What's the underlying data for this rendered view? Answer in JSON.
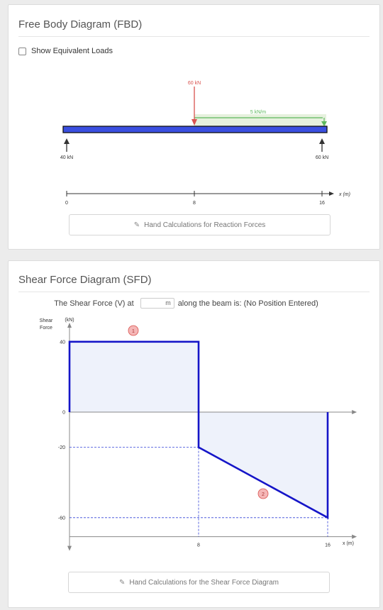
{
  "fbd": {
    "title": "Free Body Diagram (FBD)",
    "checkbox_label": "Show Equivalent Loads",
    "point_load_label": "60 kN",
    "dist_load_label": "5 kN/m",
    "reaction_left_label": "40 kN",
    "reaction_right_label": "60 kN",
    "axis_ticks": [
      "0",
      "8",
      "16"
    ],
    "axis_label": "x (m)",
    "calc_button_label": "Hand Calculations for Reaction Forces",
    "colors": {
      "beam": "#3a4fe0",
      "point_load": "#d9534f",
      "dist_load": "#5cb85c"
    }
  },
  "sfd": {
    "title": "Shear Force Diagram (SFD)",
    "query_prefix": "The Shear Force (V) at",
    "query_unit": "m",
    "query_suffix": "along the beam is: (No Position Entered)",
    "y_title_line1": "Shear",
    "y_title_line2": "Force",
    "y_unit": "(kN)",
    "x_axis_label": "x  (m)",
    "marker_1": "1",
    "marker_2": "2",
    "calc_button_label": "Hand Calculations for the Shear Force Diagram",
    "colors": {
      "line": "#1515c8",
      "fill": "#eef2fb",
      "marker": "#f5a3a3"
    }
  },
  "chart_data": {
    "type": "line",
    "title": "Shear Force Diagram (SFD)",
    "xlabel": "x (m)",
    "ylabel": "Shear Force (kN)",
    "x": [
      0,
      0,
      8,
      8,
      16,
      16
    ],
    "y": [
      0,
      40,
      40,
      -20,
      -60,
      0
    ],
    "x_ticks": [
      8,
      16
    ],
    "y_ticks": [
      40,
      0,
      -20,
      -60
    ],
    "xlim": [
      0,
      17.5
    ],
    "ylim": [
      -70,
      48
    ]
  },
  "icons": {
    "pencil": "pencil-icon"
  }
}
